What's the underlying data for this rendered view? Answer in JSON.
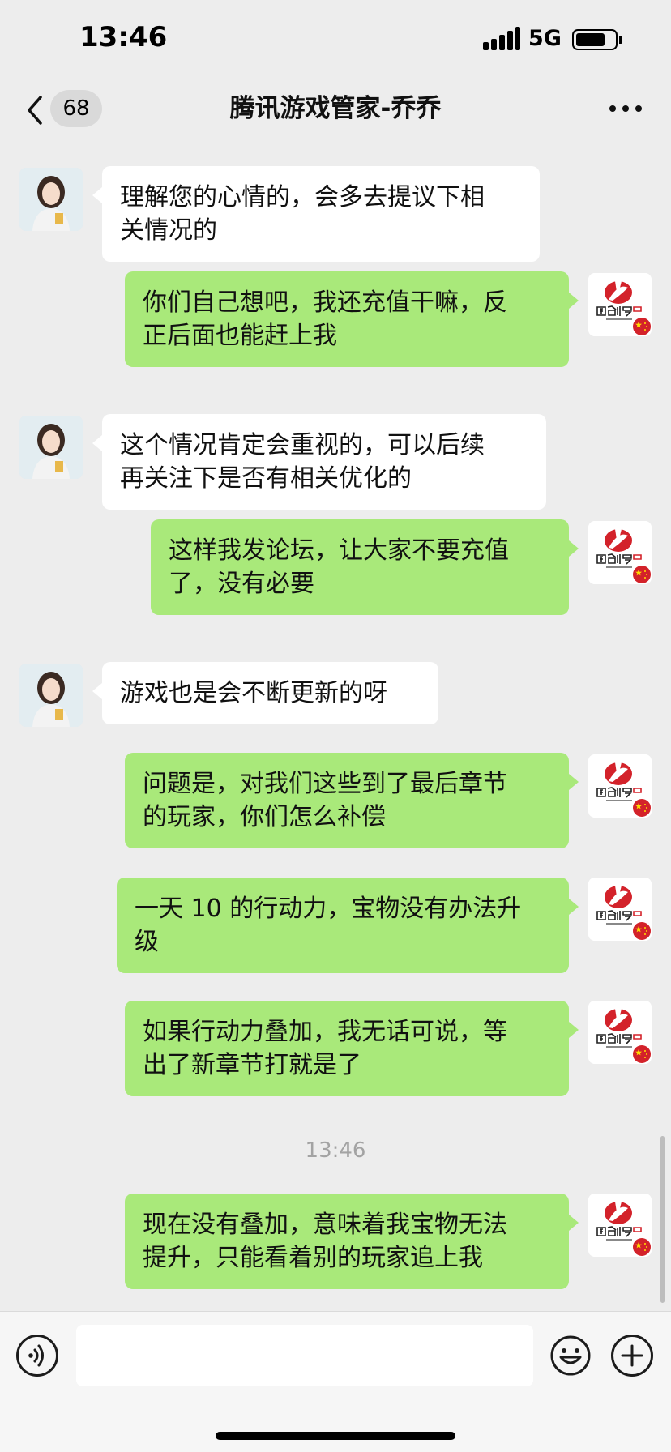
{
  "status_bar": {
    "time": "13:46",
    "network": "5G",
    "battery_level": 0.75
  },
  "nav": {
    "unread_count": "68",
    "title": "腾讯游戏管家-乔乔"
  },
  "messages": [
    {
      "sender": "agent",
      "text": "理解您的心情的，会多去提议下相\n关情况的"
    },
    {
      "sender": "me",
      "text": "你们自己想吧，我还充值干嘛，反\n正后面也能赶上我"
    },
    {
      "sender": "agent",
      "text": "这个情况肯定会重视的，可以后续\n再关注下是否有相关优化的"
    },
    {
      "sender": "me",
      "text": "这样我发论坛，让大家不要充值\n了，没有必要"
    },
    {
      "sender": "agent",
      "text": "游戏也是会不断更新的呀"
    },
    {
      "sender": "me",
      "text": "问题是，对我们这些到了最后章节\n的玩家，你们怎么补偿"
    },
    {
      "sender": "me",
      "text": "一天 10 的行动力，宝物没有办法升\n级"
    },
    {
      "sender": "me",
      "text": "如果行动力叠加，我无话可说，等\n出了新章节打就是了"
    },
    {
      "sender": "me",
      "text": "现在没有叠加，意味着我宝物无法\n提升，只能看着别的玩家追上我"
    }
  ],
  "time_divider": "13:46",
  "my_avatar": {
    "logo_text": "国创贸易",
    "logo_subtext": "GUOCHUANG",
    "brand_red": "#d3222a",
    "flag_icon": "china-flag-icon"
  },
  "colors": {
    "background": "#ededed",
    "outgoing_bubble": "#a9e97a",
    "incoming_bubble": "#ffffff"
  },
  "input": {
    "value": "",
    "placeholder": ""
  }
}
